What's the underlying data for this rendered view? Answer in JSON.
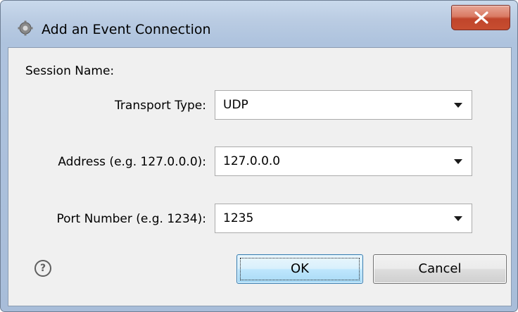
{
  "window": {
    "title": "Add an Event Connection",
    "icon": "gear-app-icon",
    "close_glyph": "X"
  },
  "form": {
    "session_name_label": "Session Name:",
    "transport_type": {
      "label": "Transport Type:",
      "value": "UDP"
    },
    "address": {
      "label": "Address (e.g. 127.0.0.0):",
      "value": "127.0.0.0"
    },
    "port": {
      "label": "Port Number (e.g. 1234):",
      "value": "1235"
    }
  },
  "footer": {
    "help_glyph": "?",
    "ok_label": "OK",
    "cancel_label": "Cancel"
  },
  "colors": {
    "close_button": "#c74d30",
    "ok_button_border": "#3c7fb1",
    "window_frame": "#aec3de"
  }
}
